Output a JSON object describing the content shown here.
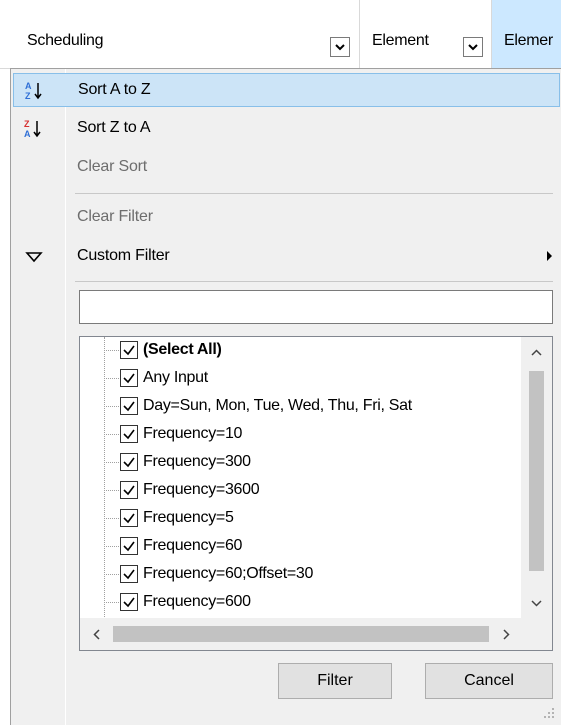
{
  "columns": [
    {
      "label": "Scheduling"
    },
    {
      "label": "Element"
    },
    {
      "label": "Elemer"
    }
  ],
  "menu": {
    "sort_az": "Sort A to Z",
    "sort_za": "Sort Z to A",
    "clear_sort": "Clear Sort",
    "clear_filter": "Clear Filter",
    "custom_filter": "Custom Filter"
  },
  "search": {
    "value": "",
    "placeholder": ""
  },
  "filter_items": [
    {
      "label": "(Select All)",
      "checked": true
    },
    {
      "label": "Any Input",
      "checked": true
    },
    {
      "label": "Day=Sun, Mon, Tue, Wed, Thu, Fri, Sat",
      "checked": true
    },
    {
      "label": "Frequency=10",
      "checked": true
    },
    {
      "label": "Frequency=300",
      "checked": true
    },
    {
      "label": "Frequency=3600",
      "checked": true
    },
    {
      "label": "Frequency=5",
      "checked": true
    },
    {
      "label": "Frequency=60",
      "checked": true
    },
    {
      "label": "Frequency=60;Offset=30",
      "checked": true
    },
    {
      "label": "Frequency=600",
      "checked": true
    }
  ],
  "buttons": {
    "filter": "Filter",
    "cancel": "Cancel"
  },
  "colors": {
    "highlight": "#cce4f7",
    "highlight_border": "#88bfe9",
    "header_active": "#cce8ff",
    "disabled_text": "#6d6d6d"
  }
}
